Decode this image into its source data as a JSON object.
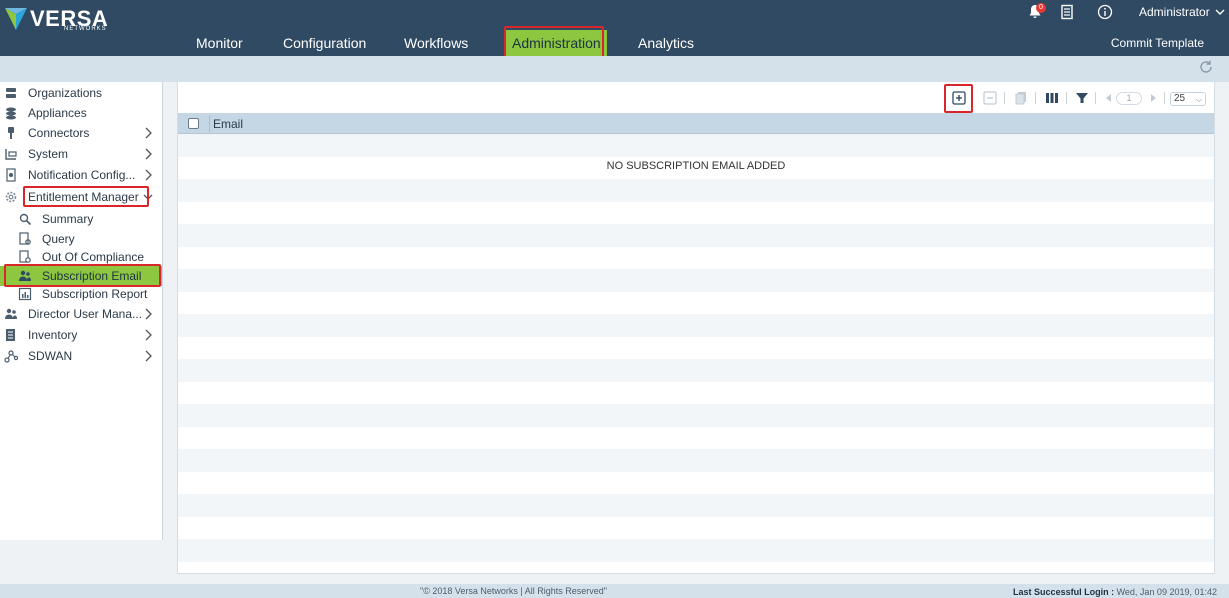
{
  "brand": {
    "name": "VERSA",
    "sub": "NETWORKS"
  },
  "nav": {
    "items": [
      {
        "label": "Monitor"
      },
      {
        "label": "Configuration"
      },
      {
        "label": "Workflows"
      },
      {
        "label": "Administration",
        "active": true
      },
      {
        "label": "Analytics"
      }
    ],
    "commit": "Commit Template"
  },
  "header": {
    "bell_count": "0",
    "user": "Administrator"
  },
  "sidebar": {
    "items": [
      {
        "label": "Organizations",
        "icon": "organizations-icon"
      },
      {
        "label": "Appliances",
        "icon": "appliances-icon"
      },
      {
        "label": "Connectors",
        "icon": "connectors-icon",
        "expandable": true
      },
      {
        "label": "System",
        "icon": "system-icon",
        "expandable": true
      },
      {
        "label": "Notification Config...",
        "icon": "notification-icon",
        "expandable": true
      },
      {
        "label": "Entitlement Manager",
        "icon": "gear-icon",
        "expanded": true
      },
      {
        "label": "Summary",
        "icon": "summary-icon",
        "sub": true
      },
      {
        "label": "Query",
        "icon": "query-icon",
        "sub": true
      },
      {
        "label": "Out Of Compliance",
        "icon": "compliance-icon",
        "sub": true
      },
      {
        "label": "Subscription Email",
        "icon": "users-icon",
        "sub": true,
        "selected": true
      },
      {
        "label": "Subscription Report",
        "icon": "report-icon",
        "sub": true
      },
      {
        "label": "Director User Mana...",
        "icon": "director-users-icon",
        "expandable": true
      },
      {
        "label": "Inventory",
        "icon": "inventory-icon",
        "expandable": true
      },
      {
        "label": "SDWAN",
        "icon": "sdwan-icon",
        "expandable": true
      }
    ]
  },
  "toolbar": {
    "page": "1",
    "per_page": "25"
  },
  "table": {
    "columns": [
      "Email"
    ],
    "empty_message": "NO SUBSCRIPTION EMAIL ADDED"
  },
  "footer": {
    "copyright": "\"© 2018 Versa Networks | All Rights Reserved\"",
    "last_login_label": "Last Successful Login :",
    "last_login_value": " Wed, Jan 09 2019, 01:42"
  },
  "colors": {
    "topbar": "#2f4a62",
    "accent": "#8dc63f",
    "highlight": "#d9262b"
  }
}
